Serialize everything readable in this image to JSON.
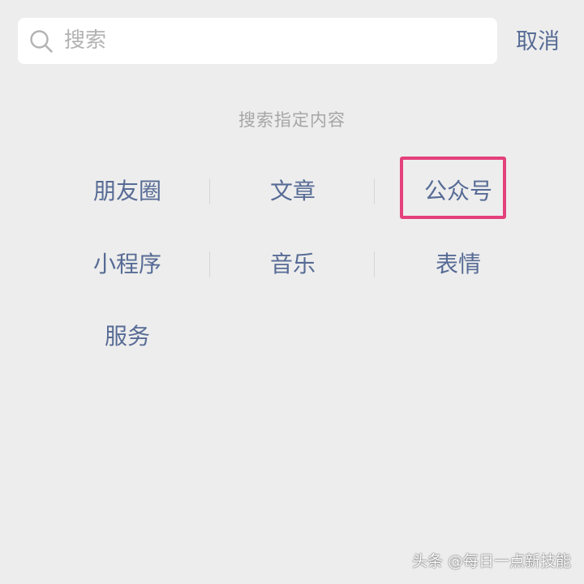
{
  "search": {
    "placeholder": "搜索",
    "value": "",
    "cancel_label": "取消"
  },
  "hint": "搜索指定内容",
  "categories": {
    "row1": [
      "朋友圈",
      "文章",
      "公众号"
    ],
    "row2": [
      "小程序",
      "音乐",
      "表情"
    ],
    "row3": [
      "服务"
    ]
  },
  "highlighted_category": "公众号",
  "watermark": "头条 @每日一点新技能",
  "colors": {
    "background": "#ededed",
    "link_blue": "#576b95",
    "hint_gray": "#a6a6a6",
    "highlight_pink": "#e4407c"
  },
  "icons": {
    "search": "search-icon"
  }
}
